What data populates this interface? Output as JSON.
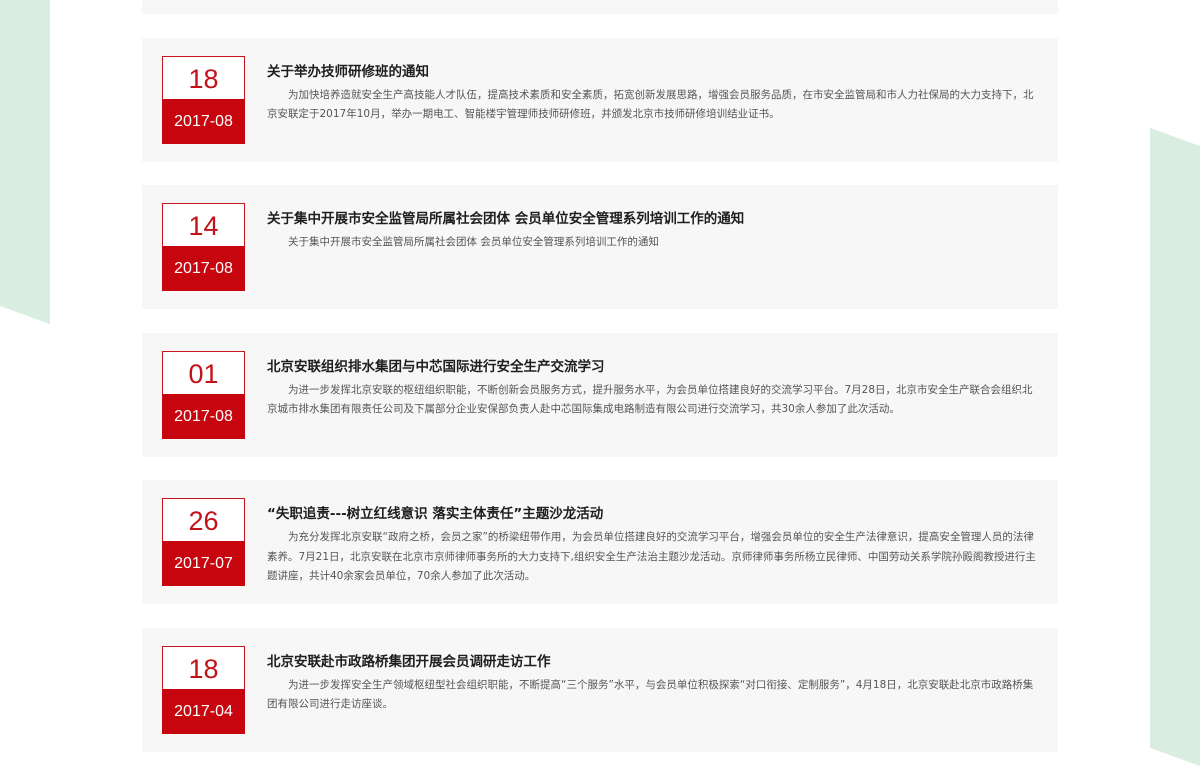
{
  "colors": {
    "accent": "#c6050f",
    "card_background": "#f7f7f7",
    "title": "#1e1e1e",
    "summary": "#555555",
    "decoration": "#d9eedf"
  },
  "news": {
    "items": [
      {
        "day": "",
        "year_month": "2017-08",
        "title": "",
        "summary": ""
      },
      {
        "day": "18",
        "year_month": "2017-08",
        "title": "关于举办技师研修班的通知",
        "summary": "为加快培养造就安全生产高技能人才队伍，提高技术素质和安全素质，拓宽创新发展思路，增强会员服务品质，在市安全监管局和市人力社保局的大力支持下，北京安联定于2017年10月，举办一期电工、智能楼宇管理师技师研修班，并颁发北京市技师研修培训结业证书。"
      },
      {
        "day": "14",
        "year_month": "2017-08",
        "title": "关于集中开展市安全监管局所属社会团体 会员单位安全管理系列培训工作的通知",
        "summary": "关于集中开展市安全监管局所属社会团体 会员单位安全管理系列培训工作的通知"
      },
      {
        "day": "01",
        "year_month": "2017-08",
        "title": "北京安联组织排水集团与中芯国际进行安全生产交流学习",
        "summary": "为进一步发挥北京安联的枢纽组织职能，不断创新会员服务方式，提升服务水平，为会员单位搭建良好的交流学习平台。7月28日，北京市安全生产联合会组织北京城市排水集团有限责任公司及下属部分企业安保部负责人赴中芯国际集成电路制造有限公司进行交流学习，共30余人参加了此次活动。"
      },
      {
        "day": "26",
        "year_month": "2017-07",
        "title": "“失职追责---树立红线意识 落实主体责任”主题沙龙活动",
        "summary": "为充分发挥北京安联“政府之桥，会员之家”的桥梁纽带作用，为会员单位搭建良好的交流学习平台，增强会员单位的安全生产法律意识，提高安全管理人员的法律素养。7月21日，北京安联在北京市京师律师事务所的大力支持下,组织安全生产法治主题沙龙活动。京师律师事务所杨立民律师、中国劳动关系学院孙殿阁教授进行主题讲座，共计40余家会员单位，70余人参加了此次活动。"
      },
      {
        "day": "18",
        "year_month": "2017-04",
        "title": "北京安联赴市政路桥集团开展会员调研走访工作",
        "summary": "为进一步发挥安全生产领域枢纽型社会组织职能，不断提高“三个服务”水平，与会员单位积极探索“对口衔接、定制服务”，4月18日，北京安联赴北京市政路桥集团有限公司进行走访座谈。"
      }
    ]
  }
}
